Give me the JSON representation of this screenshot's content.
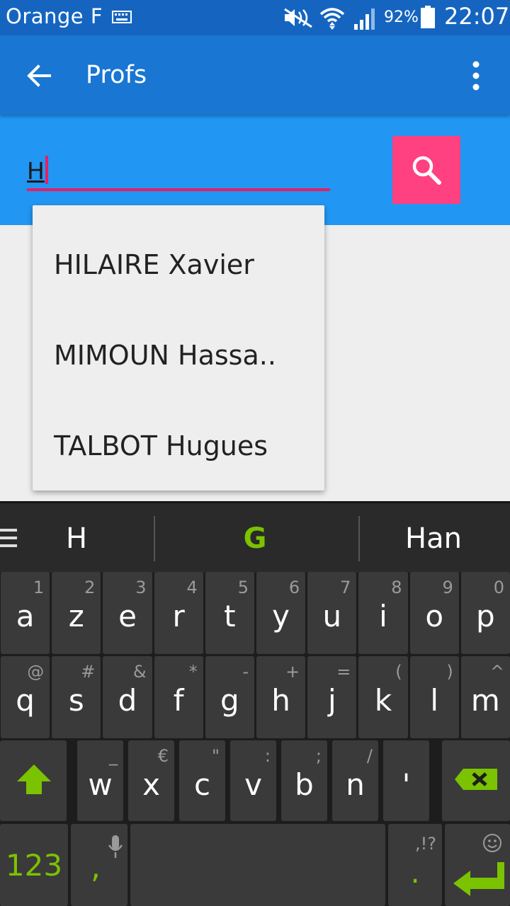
{
  "status_bar": {
    "carrier": "Orange F",
    "battery_percent": "92%",
    "time": "22:07"
  },
  "app_bar": {
    "title": "Profs"
  },
  "search": {
    "value": "H"
  },
  "dropdown": {
    "items": [
      "HILAIRE Xavier",
      "MIMOUN Hassa..",
      "TALBOT Hugues"
    ]
  },
  "keyboard": {
    "suggestions": [
      "H",
      "G",
      "Han"
    ],
    "row1": [
      {
        "k": "a",
        "s": "1"
      },
      {
        "k": "z",
        "s": "2"
      },
      {
        "k": "e",
        "s": "3"
      },
      {
        "k": "r",
        "s": "4"
      },
      {
        "k": "t",
        "s": "5"
      },
      {
        "k": "y",
        "s": "6"
      },
      {
        "k": "u",
        "s": "7"
      },
      {
        "k": "i",
        "s": "8"
      },
      {
        "k": "o",
        "s": "9"
      },
      {
        "k": "p",
        "s": "0"
      }
    ],
    "row2": [
      {
        "k": "q",
        "s": "@"
      },
      {
        "k": "s",
        "s": "#"
      },
      {
        "k": "d",
        "s": "&"
      },
      {
        "k": "f",
        "s": "*"
      },
      {
        "k": "g",
        "s": "-"
      },
      {
        "k": "h",
        "s": "+"
      },
      {
        "k": "j",
        "s": "="
      },
      {
        "k": "k",
        "s": "("
      },
      {
        "k": "l",
        "s": ")"
      },
      {
        "k": "m",
        "s": "^"
      }
    ],
    "row3": [
      {
        "k": "w",
        "s": "_"
      },
      {
        "k": "x",
        "s": "€"
      },
      {
        "k": "c",
        "s": "\""
      },
      {
        "k": "v",
        "s": ":"
      },
      {
        "k": "b",
        "s": ";"
      },
      {
        "k": "n",
        "s": "/"
      },
      {
        "k": "'",
        "s": ""
      }
    ],
    "numbers_key": "123",
    "comma_key": ",",
    "period_key": ".",
    "period_sub": ",!?",
    "accent_color": "#7bc200"
  },
  "colors": {
    "status_bar": "#1565c0",
    "app_bar": "#1976d2",
    "search_area": "#2196f3",
    "search_button": "#ff4081",
    "underline": "#e91e63"
  }
}
